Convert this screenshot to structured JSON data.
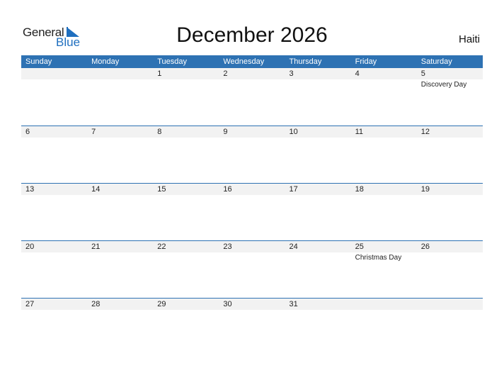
{
  "logo": {
    "general": "General",
    "blue": "Blue"
  },
  "title": "December 2026",
  "country": "Haiti",
  "colors": {
    "accent": "#2e72b3",
    "band": "#f2f2f2"
  },
  "weekdays": [
    "Sunday",
    "Monday",
    "Tuesday",
    "Wednesday",
    "Thursday",
    "Friday",
    "Saturday"
  ],
  "weeks": [
    [
      {
        "day": "",
        "holiday": ""
      },
      {
        "day": "",
        "holiday": ""
      },
      {
        "day": "1",
        "holiday": ""
      },
      {
        "day": "2",
        "holiday": ""
      },
      {
        "day": "3",
        "holiday": ""
      },
      {
        "day": "4",
        "holiday": ""
      },
      {
        "day": "5",
        "holiday": "Discovery Day"
      }
    ],
    [
      {
        "day": "6",
        "holiday": ""
      },
      {
        "day": "7",
        "holiday": ""
      },
      {
        "day": "8",
        "holiday": ""
      },
      {
        "day": "9",
        "holiday": ""
      },
      {
        "day": "10",
        "holiday": ""
      },
      {
        "day": "11",
        "holiday": ""
      },
      {
        "day": "12",
        "holiday": ""
      }
    ],
    [
      {
        "day": "13",
        "holiday": ""
      },
      {
        "day": "14",
        "holiday": ""
      },
      {
        "day": "15",
        "holiday": ""
      },
      {
        "day": "16",
        "holiday": ""
      },
      {
        "day": "17",
        "holiday": ""
      },
      {
        "day": "18",
        "holiday": ""
      },
      {
        "day": "19",
        "holiday": ""
      }
    ],
    [
      {
        "day": "20",
        "holiday": ""
      },
      {
        "day": "21",
        "holiday": ""
      },
      {
        "day": "22",
        "holiday": ""
      },
      {
        "day": "23",
        "holiday": ""
      },
      {
        "day": "24",
        "holiday": ""
      },
      {
        "day": "25",
        "holiday": "Christmas Day"
      },
      {
        "day": "26",
        "holiday": ""
      }
    ],
    [
      {
        "day": "27",
        "holiday": ""
      },
      {
        "day": "28",
        "holiday": ""
      },
      {
        "day": "29",
        "holiday": ""
      },
      {
        "day": "30",
        "holiday": ""
      },
      {
        "day": "31",
        "holiday": ""
      },
      {
        "day": "",
        "holiday": ""
      },
      {
        "day": "",
        "holiday": ""
      }
    ]
  ]
}
